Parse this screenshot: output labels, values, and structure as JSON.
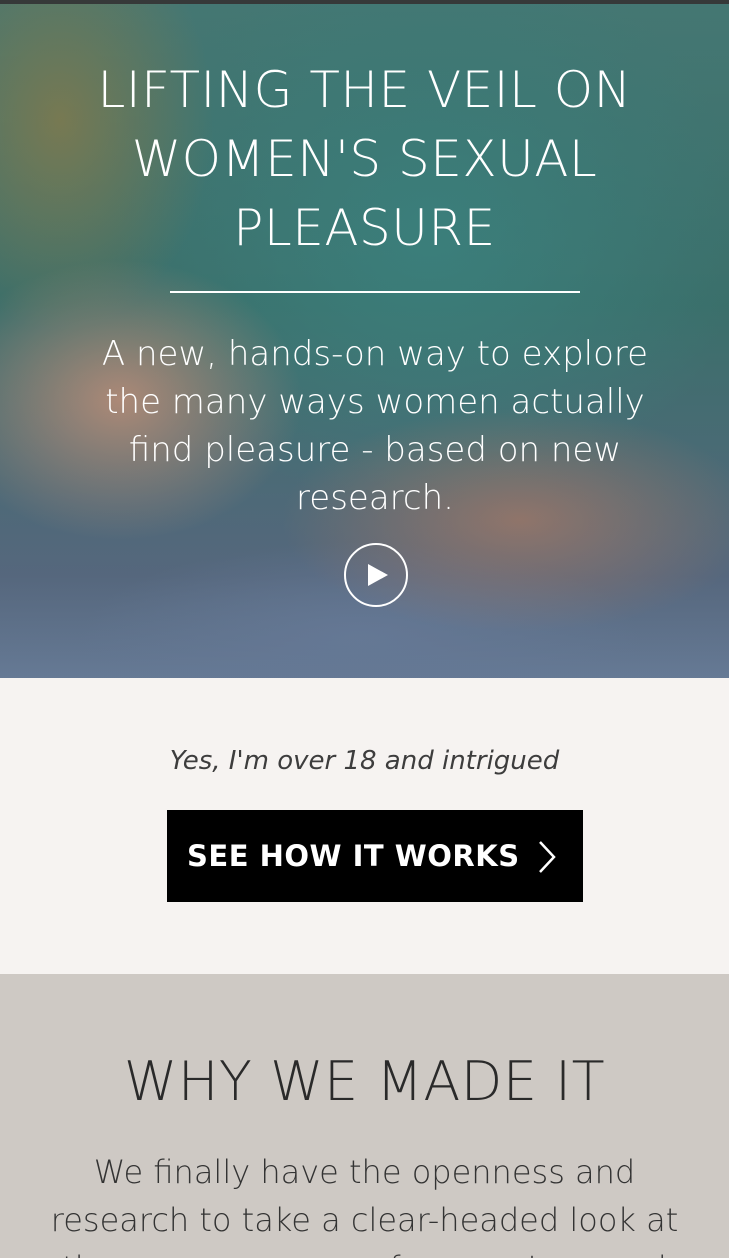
{
  "hero": {
    "title": "LIFTING THE VEIL ON WOMEN'S SEXUAL PLEASURE",
    "subtitle": "A new, hands-on way to explore the many ways women actually find pleasure - based on new research.",
    "play_icon": "play-icon"
  },
  "age_gate": {
    "confirm_text": "Yes, I'm over 18 and intrigued",
    "cta_label": "SEE HOW IT WORKS",
    "cta_icon": "chevron-right-icon"
  },
  "why": {
    "heading": "WHY WE MADE IT",
    "body": "We finally have the openness and research to take a clear-headed look at the many nuances of women's sexual"
  },
  "colors": {
    "hero_teal": "#408a86",
    "section_light": "#f6f3f1",
    "section_gray": "#cec9c4",
    "button_black": "#000000",
    "text_white": "#ffffff"
  }
}
